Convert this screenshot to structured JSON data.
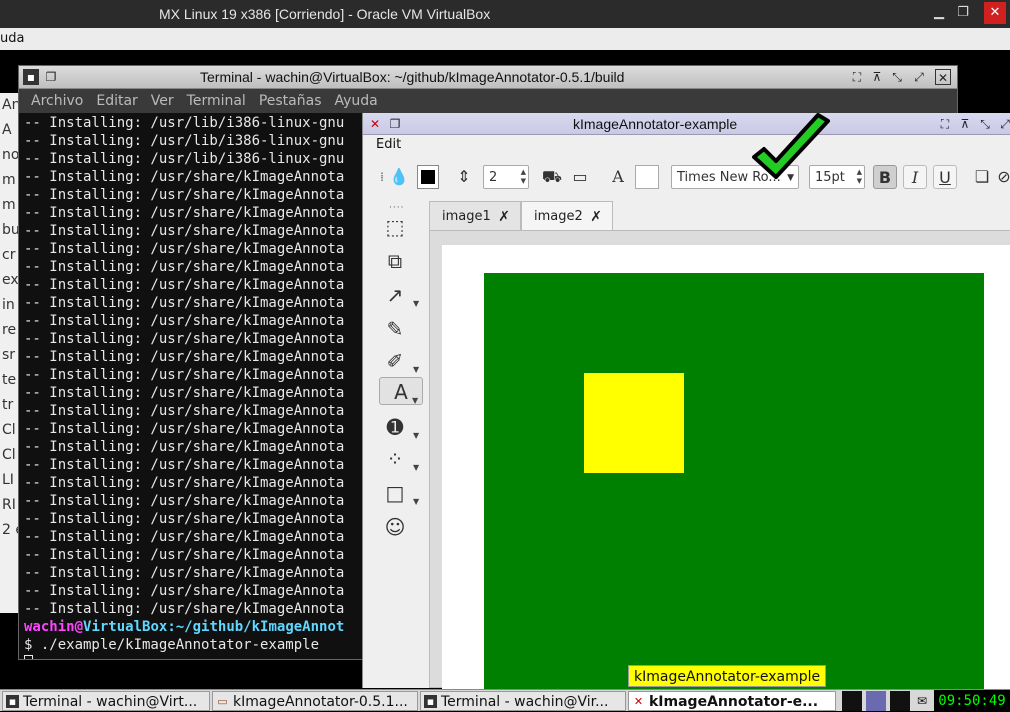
{
  "vbox": {
    "title": "MX Linux 19 x386 [Corriendo] - Oracle VM VirtualBox",
    "menu_partial": "uda",
    "controls": {
      "minimize": "▁",
      "restore": "❐",
      "close": "✕"
    }
  },
  "bg_window": {
    "items": [
      "An",
      "A",
      "no",
      "m",
      "m",
      "bu",
      "cr",
      "ex",
      "in",
      "re",
      "sr",
      "te",
      "tr",
      "Cl",
      "Cl",
      "LI",
      "RI",
      "2 e"
    ]
  },
  "terminal": {
    "title": "Terminal - wachin@VirtualBox: ~/github/kImageAnnotator-0.5.1/build",
    "menu": [
      "Archivo",
      "Editar",
      "Ver",
      "Terminal",
      "Pestañas",
      "Ayuda"
    ],
    "lines": [
      "-- Installing: /usr/lib/i386-linux-gnu",
      "-- Installing: /usr/lib/i386-linux-gnu",
      "-- Installing: /usr/lib/i386-linux-gnu",
      "-- Installing: /usr/share/kImageAnnota",
      "-- Installing: /usr/share/kImageAnnota",
      "-- Installing: /usr/share/kImageAnnota",
      "-- Installing: /usr/share/kImageAnnota",
      "-- Installing: /usr/share/kImageAnnota",
      "-- Installing: /usr/share/kImageAnnota",
      "-- Installing: /usr/share/kImageAnnota",
      "-- Installing: /usr/share/kImageAnnota",
      "-- Installing: /usr/share/kImageAnnota",
      "-- Installing: /usr/share/kImageAnnota",
      "-- Installing: /usr/share/kImageAnnota",
      "-- Installing: /usr/share/kImageAnnota",
      "-- Installing: /usr/share/kImageAnnota",
      "-- Installing: /usr/share/kImageAnnota",
      "-- Installing: /usr/share/kImageAnnota",
      "-- Installing: /usr/share/kImageAnnota",
      "-- Installing: /usr/share/kImageAnnota",
      "-- Installing: /usr/share/kImageAnnota",
      "-- Installing: /usr/share/kImageAnnota",
      "-- Installing: /usr/share/kImageAnnota",
      "-- Installing: /usr/share/kImageAnnota",
      "-- Installing: /usr/share/kImageAnnota",
      "-- Installing: /usr/share/kImageAnnota",
      "-- Installing: /usr/share/kImageAnnota",
      "-- Installing: /usr/share/kImageAnnota"
    ],
    "prompt_user": "wachin",
    "prompt_at": "@",
    "prompt_host": "VirtualBox",
    "prompt_path": ":~/github/kImageAnnot",
    "command": "$ ./example/kImageAnnotator-example"
  },
  "kia": {
    "title": "kImageAnnotator-example",
    "menu_edit": "Edit",
    "width_value": "2",
    "font_name": "Times New Ro...",
    "font_size": "15pt",
    "tabs": [
      {
        "label": "image1",
        "close": "✗"
      },
      {
        "label": "image2",
        "close": "✗"
      }
    ],
    "colors": {
      "canvas_bg": "#008000",
      "square": "#ffff00",
      "check": "#22cc22"
    }
  },
  "tooltip": "kImageAnnotator-example",
  "taskbar": {
    "tasks": [
      "Terminal - wachin@Virt...",
      "kImageAnnotator-0.5.1...",
      "Terminal - wachin@Vir...",
      "kImageAnnotator-e..."
    ],
    "clock": "09:50:49"
  }
}
